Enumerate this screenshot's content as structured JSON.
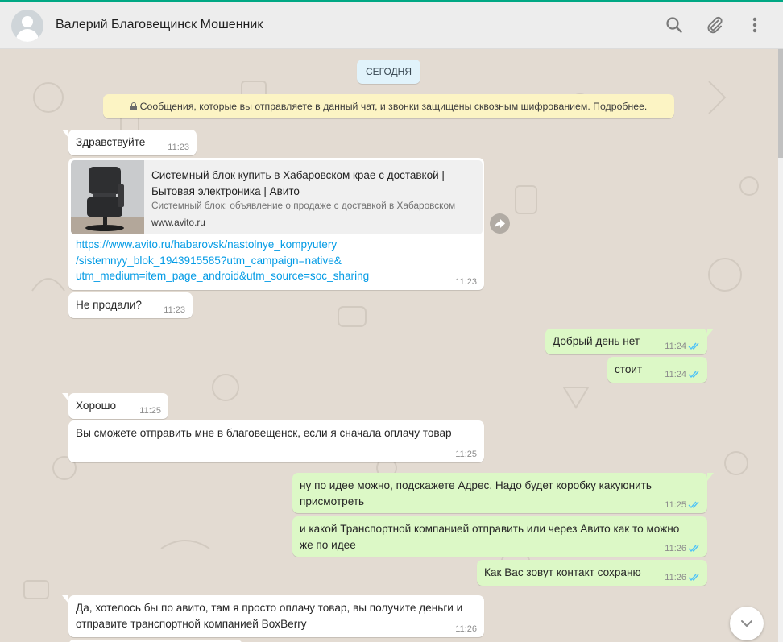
{
  "header": {
    "contact_name": "Валерий Благовещинск Мошенник",
    "icons": [
      "search-icon",
      "paperclip-icon",
      "menu-dots-icon"
    ]
  },
  "colors": {
    "incoming_bubble": "#ffffff",
    "outgoing_bubble": "#dcf8c6",
    "chat_background": "#e5ddd5",
    "link": "#039be5",
    "read_ticks": "#4fc3f7",
    "encryption_notice": "#fcf4c4",
    "day_pill": "#e1f3fb"
  },
  "chat": {
    "day_label": "СЕГОДНЯ",
    "encryption_notice": "Сообщения, которые вы отправляете в данный чат, и звонки защищены сквозным шифрованием. Подробнее.",
    "messages": [
      {
        "dir": "in",
        "text": "Здравствуйте",
        "time": "11:23"
      },
      {
        "dir": "in",
        "preview_title_1": "Системный блок купить в Хабаровском крае с доставкой |",
        "preview_title_2": "Бытовая электроника | Авито",
        "preview_desc": "Системный блок: объявление о продаже с доставкой в Хабаровском",
        "preview_domain": "www.avito.ru",
        "link_1": "https://www.avito.ru/habarovsk/nastolnye_kompyutery",
        "link_2": "/sistemnyy_blok_1943915585?utm_campaign=native&",
        "link_3": "utm_medium=item_page_android&utm_source=soc_sharing",
        "time": "11:23"
      },
      {
        "dir": "in",
        "text": "Не продали?",
        "time": "11:23"
      },
      {
        "dir": "out",
        "text": "Добрый день нет",
        "time": "11:24"
      },
      {
        "dir": "out",
        "text": "стоит",
        "time": "11:24"
      },
      {
        "dir": "in",
        "text": "Хорошо",
        "time": "11:25"
      },
      {
        "dir": "in",
        "text": "Вы сможете отправить мне в благовещенск, если я сначала оплачу товар",
        "time": "11:25"
      },
      {
        "dir": "out",
        "line_1": "ну по идее можно, подскажете Адрес. Надо будет коробку какуюнить",
        "line_2": "присмотреть",
        "time": "11:25"
      },
      {
        "dir": "out",
        "line_1": "и какой Транспортной компанией отправить или через Авито как то можно",
        "line_2": "же по идее",
        "time": "11:26"
      },
      {
        "dir": "out",
        "text": "Как Вас зовут контакт сохраню",
        "time": "11:26"
      },
      {
        "dir": "in",
        "line_1": "Да, хотелось бы по авито, там я просто оплачу товар, вы получите деньги и",
        "line_2": "отправите транспортной компанией BoxBerry",
        "time": "11:26"
      }
    ]
  }
}
